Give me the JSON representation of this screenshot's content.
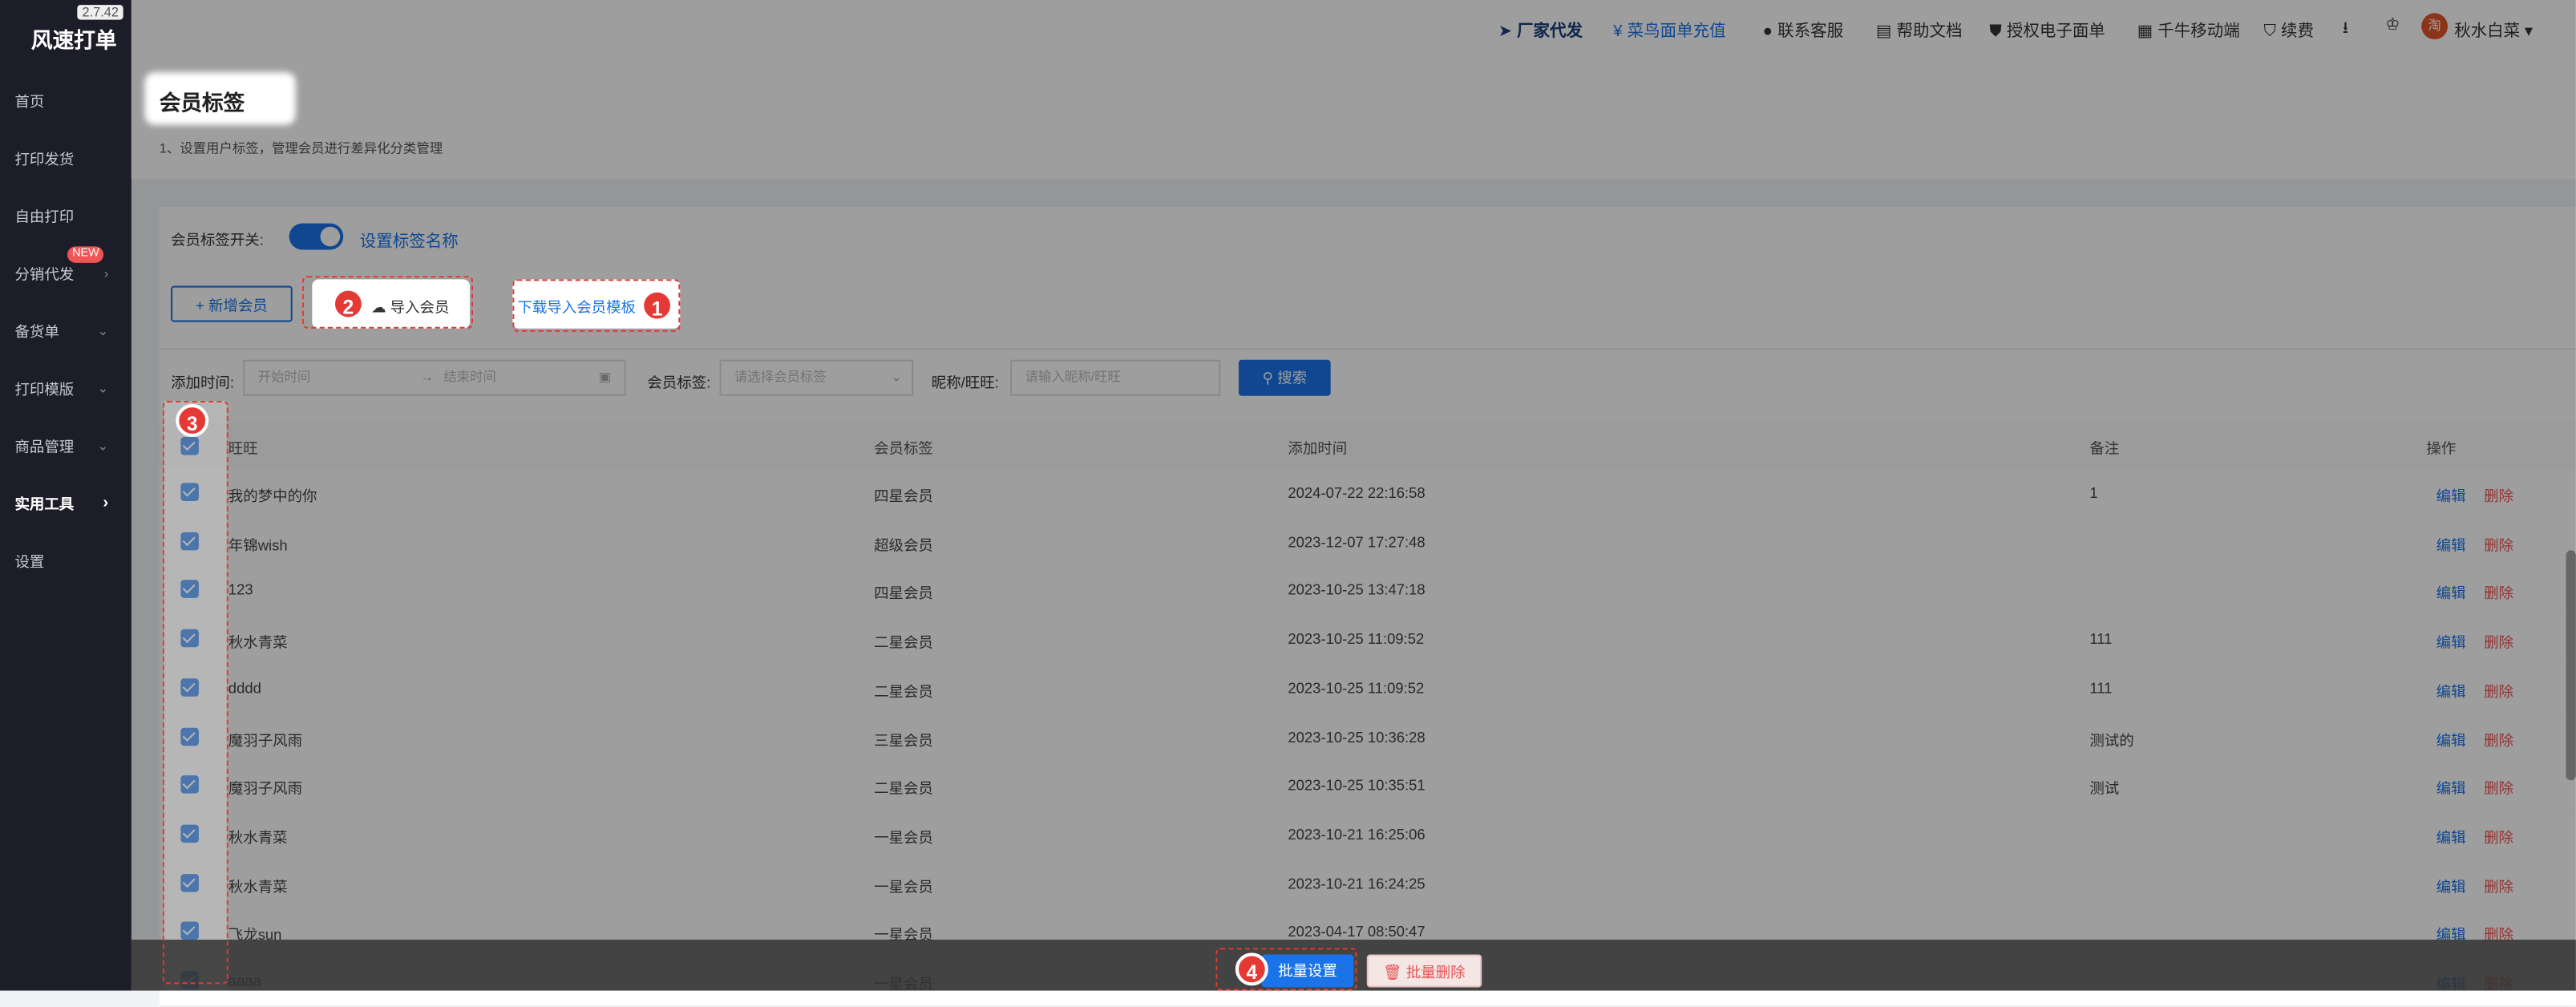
{
  "app": {
    "title": "风速打单",
    "version": "2.7.42"
  },
  "sidebar": {
    "items": [
      {
        "label": "首页",
        "chevron": ""
      },
      {
        "label": "打印发货",
        "chevron": ""
      },
      {
        "label": "自由打印",
        "chevron": ""
      },
      {
        "label": "分销代发",
        "chevron": "›",
        "badge": "NEW"
      },
      {
        "label": "备货单",
        "chevron": "⌄"
      },
      {
        "label": "打印模版",
        "chevron": "⌄"
      },
      {
        "label": "商品管理",
        "chevron": "⌄"
      },
      {
        "label": "实用工具",
        "chevron": "›"
      },
      {
        "label": "设置",
        "chevron": ""
      }
    ]
  },
  "topbar": {
    "items": [
      {
        "label": "厂家代发",
        "icon": "send-icon"
      },
      {
        "label": "菜鸟面单充值",
        "icon": "yen-icon"
      },
      {
        "label": "联系客服",
        "icon": "service-icon"
      },
      {
        "label": "帮助文档",
        "icon": "doc-icon"
      },
      {
        "label": "授权电子面单",
        "icon": "shield-icon"
      },
      {
        "label": "千牛移动端",
        "icon": "qr-icon"
      },
      {
        "label": "续费",
        "icon": "renew-icon"
      }
    ],
    "user": {
      "name": "秋水白菜",
      "avatar_text": "淘"
    }
  },
  "header": {
    "title": "会员标签",
    "desc": "1、设置用户标签，管理会员进行差异化分类管理"
  },
  "toolbar": {
    "switch_label": "会员标签开关:",
    "set_names_link": "设置标签名称",
    "add_member": "+ 新增会员",
    "import_member": "导入会员",
    "download_template": "下载导入会员模板"
  },
  "filters": {
    "time_label": "添加时间:",
    "start_placeholder": "开始时间",
    "arrow": "→",
    "end_placeholder": "结束时间",
    "tag_label": "会员标签:",
    "tag_placeholder": "请选择会员标签",
    "nick_label": "昵称/旺旺:",
    "nick_placeholder": "请输入昵称/旺旺",
    "search_btn": "搜索"
  },
  "table": {
    "headers": [
      "旺旺",
      "会员标签",
      "添加时间",
      "备注",
      "操作"
    ],
    "edit_label": "编辑",
    "delete_label": "删除",
    "rows": [
      {
        "name": "我的梦中的你",
        "tag": "四星会员",
        "time": "2024-07-22 22:16:58",
        "note": "1"
      },
      {
        "name": "年锦wish",
        "tag": "超级会员",
        "time": "2023-12-07 17:27:48",
        "note": ""
      },
      {
        "name": "123",
        "tag": "四星会员",
        "time": "2023-10-25 13:47:18",
        "note": ""
      },
      {
        "name": "秋水青菜",
        "tag": "二星会员",
        "time": "2023-10-25 11:09:52",
        "note": "111"
      },
      {
        "name": "dddd",
        "tag": "二星会员",
        "time": "2023-10-25 11:09:52",
        "note": "111"
      },
      {
        "name": "魔羽子风雨",
        "tag": "三星会员",
        "time": "2023-10-25 10:36:28",
        "note": "测试的"
      },
      {
        "name": "魔羽子风雨",
        "tag": "二星会员",
        "time": "2023-10-25 10:35:51",
        "note": "测试"
      },
      {
        "name": "秋水青菜",
        "tag": "一星会员",
        "time": "2023-10-21 16:25:06",
        "note": ""
      },
      {
        "name": "秋水青菜",
        "tag": "一星会员",
        "time": "2023-10-21 16:24:25",
        "note": ""
      },
      {
        "name": "飞龙sun",
        "tag": "一星会员",
        "time": "2023-04-17 08:50:47",
        "note": ""
      },
      {
        "name": "aaaa",
        "tag": "一星会员",
        "time": "",
        "note": ""
      }
    ]
  },
  "bottom": {
    "batch_set": "批量设置",
    "batch_delete": "批量删除"
  },
  "annotations": [
    "1",
    "2",
    "3",
    "4"
  ],
  "colors": {
    "accent": "#1a73e8",
    "danger": "#e55353",
    "sidebar": "#1d1d29",
    "marker": "#e53935"
  }
}
